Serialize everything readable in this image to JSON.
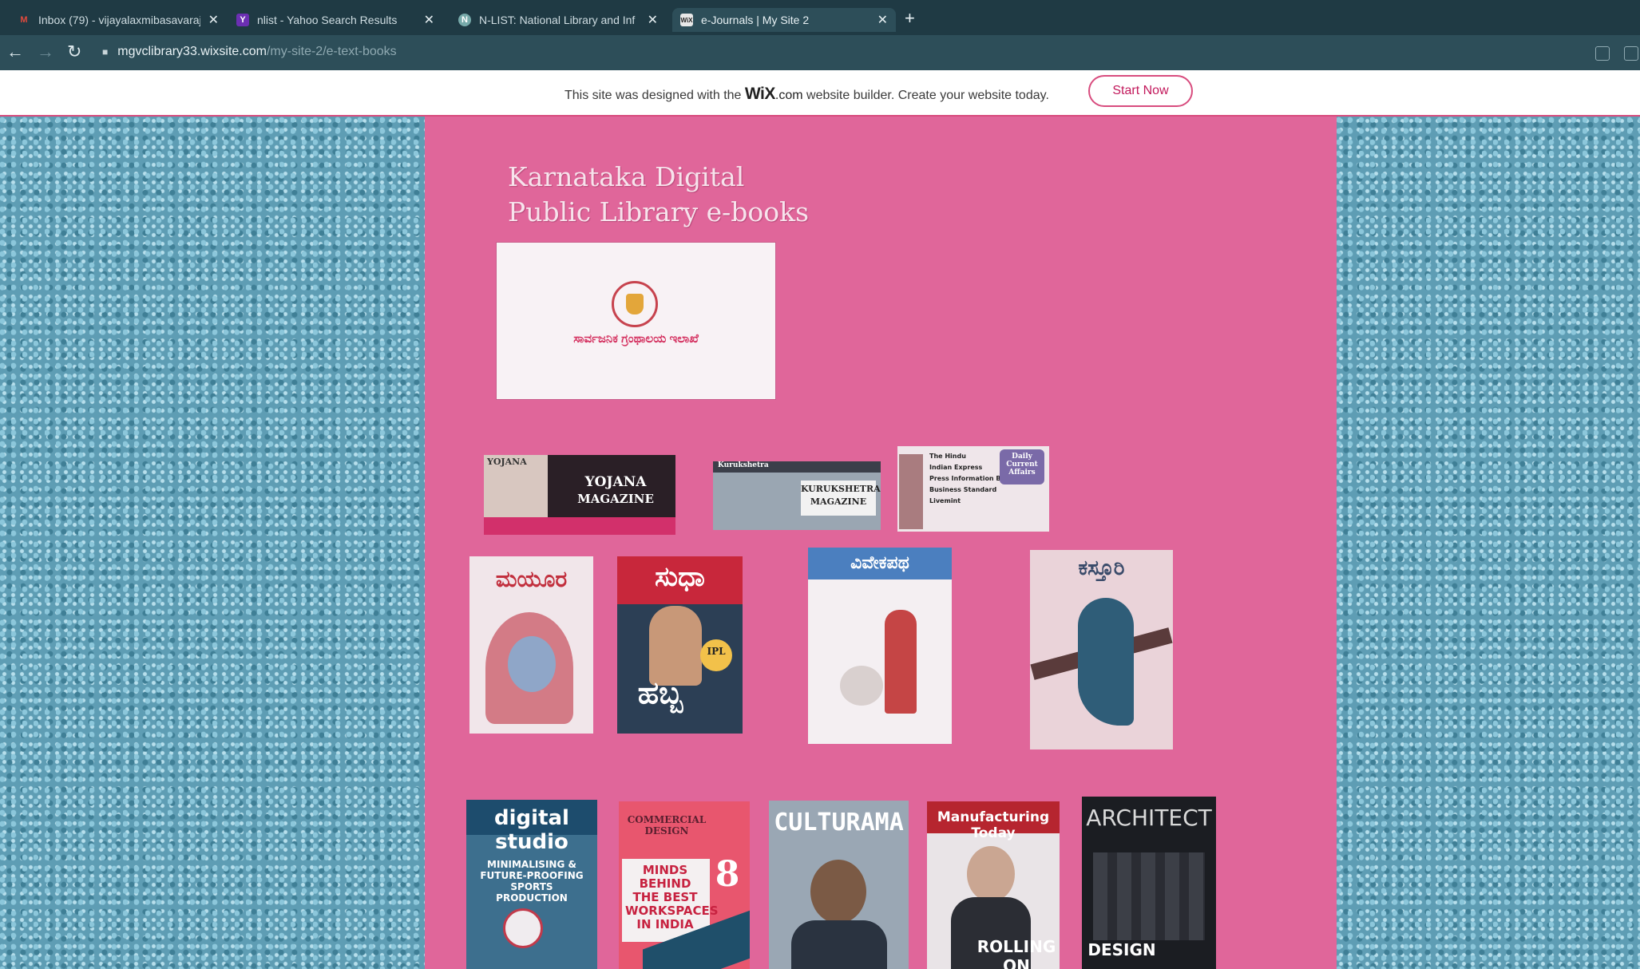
{
  "browser": {
    "tabs": [
      {
        "label": "Inbox (79) - vijayalaxmibasavaraj",
        "icon": "gmail-icon",
        "active": false
      },
      {
        "label": "nlist - Yahoo Search Results",
        "icon": "yahoo-icon",
        "active": false
      },
      {
        "label": "N-LIST: National Library and Inf",
        "icon": "site-icon",
        "active": false
      },
      {
        "label": "e-Journals | My Site 2",
        "icon": "wix-icon",
        "active": true
      }
    ],
    "new_tab": "+",
    "close": "✕",
    "url_host": "mgvclibrary33.wixsite.com",
    "url_path": "/my-site-2/e-text-books"
  },
  "wix_banner": {
    "text_before": "This site was designed with the",
    "brand": "WiX",
    "brand_suffix": ".com",
    "text_after": "website builder. Create your website today.",
    "button": "Start Now"
  },
  "page": {
    "title_line1": "Karnataka Digital",
    "title_line2": "Public Library e-books",
    "logo_caption": "ಸಾರ್ವಜನಿಕ ಗ್ರಂಥಾಲಯ ಇಲಾಖೆ",
    "covers": {
      "yojana": {
        "small": "YOJANA",
        "title1": "YOJANA",
        "title2": "MAGAZINE"
      },
      "kurukshetra": {
        "small": "Kurukshetra",
        "title1": "KURUKSHETRA",
        "title2": "MAGAZINE"
      },
      "newspapers": {
        "items": [
          "The Hindu",
          "Indian Express",
          "Press Information Bureau",
          "Business Standard",
          "Livemint"
        ],
        "badge": "Daily Current Affairs"
      },
      "mayura": {
        "title": "ಮಯೂರ"
      },
      "sudha": {
        "title": "ಸುಧಾ",
        "tag": "IPL",
        "big": "ಹಬ್ಬ"
      },
      "vivekapatha": {
        "title": "ವಿವೇಕಪಥ"
      },
      "kasturi": {
        "title": "ಕಸ್ತೂರಿ"
      },
      "digital_studio": {
        "title": "digital studio",
        "sub": "MINIMALISING & FUTURE-PROOFING SPORTS PRODUCTION"
      },
      "commercial_design": {
        "title": "COMMERCIAL DESIGN",
        "big": "MINDS BEHIND THE BEST WORKSPACES IN INDIA",
        "num": "8"
      },
      "culturama": {
        "title": "CULTURAMA"
      },
      "manufacturing": {
        "title": "Manufacturing Today",
        "sub": "ROLLING ON"
      },
      "architect": {
        "title": "ARCHITECT",
        "sub": "DESIGN"
      }
    }
  },
  "colors": {
    "chrome_dark": "#1f3a44",
    "chrome": "#2d4e59",
    "strip_pink": "#e0669a",
    "accent": "#d84c7e",
    "side_blue": "#5e9db4"
  }
}
